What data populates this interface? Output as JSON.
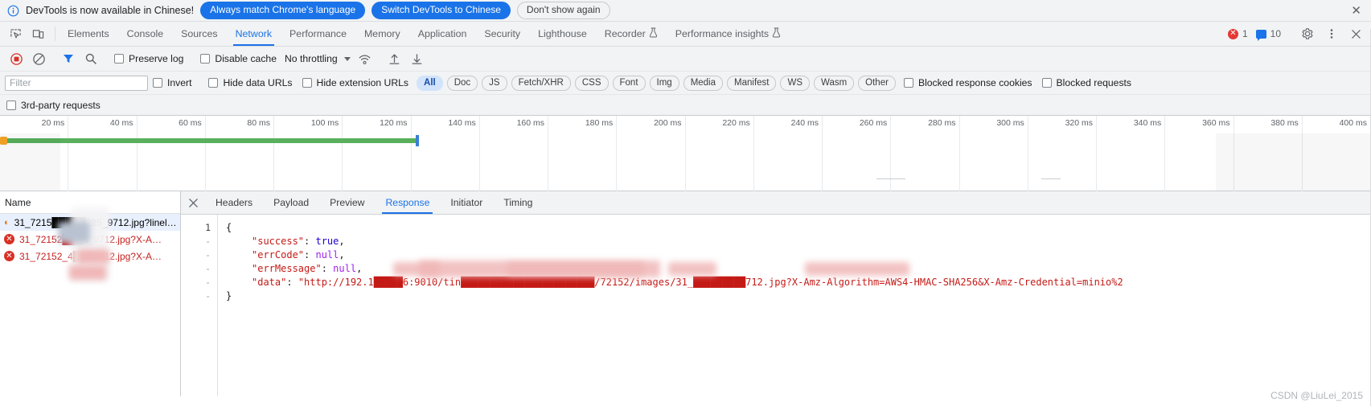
{
  "infobar": {
    "icon": "info-icon",
    "message": "DevTools is now available in Chinese!",
    "btn_always": "Always match Chrome's language",
    "btn_switch": "Switch DevTools to Chinese",
    "btn_dismiss": "Don't show again",
    "close": "✕"
  },
  "tabbar": {
    "inspect_icon": "inspect-element-icon",
    "device_icon": "device-toolbar-icon",
    "tabs": [
      {
        "label": "Elements",
        "active": false,
        "flask": false
      },
      {
        "label": "Console",
        "active": false,
        "flask": false
      },
      {
        "label": "Sources",
        "active": false,
        "flask": false
      },
      {
        "label": "Network",
        "active": true,
        "flask": false
      },
      {
        "label": "Performance",
        "active": false,
        "flask": false
      },
      {
        "label": "Memory",
        "active": false,
        "flask": false
      },
      {
        "label": "Application",
        "active": false,
        "flask": false
      },
      {
        "label": "Security",
        "active": false,
        "flask": false
      },
      {
        "label": "Lighthouse",
        "active": false,
        "flask": false
      },
      {
        "label": "Recorder",
        "active": false,
        "flask": true
      },
      {
        "label": "Performance insights",
        "active": false,
        "flask": true
      }
    ],
    "error_count": "1",
    "message_count": "10",
    "settings_icon": "gear-icon",
    "more_icon": "kebab-menu-icon",
    "close_icon": "close-icon"
  },
  "nettoolbar": {
    "record_icon": "record-stop-icon",
    "clear_icon": "clear-network-icon",
    "filter_icon": "filter-funnel-icon",
    "search_icon": "search-icon",
    "preserve_log": "Preserve log",
    "disable_cache": "Disable cache",
    "throttling": "No throttling",
    "wifi_icon": "network-conditions-icon",
    "import_icon": "import-har-icon",
    "export_icon": "export-har-icon"
  },
  "filterrow": {
    "filter_placeholder": "Filter",
    "filter_value": "",
    "invert": "Invert",
    "hide_data_urls": "Hide data URLs",
    "hide_extension_urls": "Hide extension URLs",
    "type_pills": [
      {
        "label": "All",
        "selected": true
      },
      {
        "label": "Doc",
        "selected": false
      },
      {
        "label": "JS",
        "selected": false
      },
      {
        "label": "Fetch/XHR",
        "selected": false
      },
      {
        "label": "CSS",
        "selected": false
      },
      {
        "label": "Font",
        "selected": false
      },
      {
        "label": "Img",
        "selected": false
      },
      {
        "label": "Media",
        "selected": false
      },
      {
        "label": "Manifest",
        "selected": false
      },
      {
        "label": "WS",
        "selected": false
      },
      {
        "label": "Wasm",
        "selected": false
      },
      {
        "label": "Other",
        "selected": false
      }
    ],
    "blocked_response_cookies": "Blocked response cookies",
    "blocked_requests": "Blocked requests",
    "third_party_requests": "3rd-party requests"
  },
  "overview": {
    "ticks": [
      "20 ms",
      "40 ms",
      "60 ms",
      "80 ms",
      "100 ms",
      "120 ms",
      "140 ms",
      "160 ms",
      "180 ms",
      "200 ms",
      "220 ms",
      "240 ms",
      "260 ms",
      "280 ms",
      "300 ms",
      "320 ms",
      "340 ms",
      "360 ms",
      "380 ms",
      "400 ms"
    ]
  },
  "requests": {
    "column_header": "Name",
    "rows": [
      {
        "name": "31_7215█████285_9712.jpg?linel…",
        "icon": "info-circle-icon",
        "selected": true,
        "error": false
      },
      {
        "name": "31_72152███5_9712.jpg?X-A…",
        "icon": "error-circle-icon",
        "selected": false,
        "error": true
      },
      {
        "name": "31_72152_4███9712.jpg?X-A…",
        "icon": "error-circle-icon",
        "selected": false,
        "error": true
      }
    ]
  },
  "detail": {
    "close_icon": "close-panel-icon",
    "tabs": [
      {
        "label": "Headers",
        "active": false
      },
      {
        "label": "Payload",
        "active": false
      },
      {
        "label": "Preview",
        "active": false
      },
      {
        "label": "Response",
        "active": true
      },
      {
        "label": "Initiator",
        "active": false
      },
      {
        "label": "Timing",
        "active": false
      }
    ],
    "gutter": [
      "1",
      "-",
      "-",
      "-",
      "-",
      "-"
    ],
    "json_lines": [
      {
        "indent": 0,
        "parts": [
          {
            "t": "{",
            "c": "punc"
          }
        ]
      },
      {
        "indent": 1,
        "parts": [
          {
            "t": "\"success\"",
            "c": "k"
          },
          {
            "t": ": ",
            "c": "punc"
          },
          {
            "t": "true",
            "c": "b"
          },
          {
            "t": ",",
            "c": "punc"
          }
        ]
      },
      {
        "indent": 1,
        "parts": [
          {
            "t": "\"errCode\"",
            "c": "k"
          },
          {
            "t": ": ",
            "c": "punc"
          },
          {
            "t": "null",
            "c": "n"
          },
          {
            "t": ",",
            "c": "punc"
          }
        ]
      },
      {
        "indent": 1,
        "parts": [
          {
            "t": "\"errMessage\"",
            "c": "k"
          },
          {
            "t": ": ",
            "c": "punc"
          },
          {
            "t": "null",
            "c": "n"
          },
          {
            "t": ",",
            "c": "punc"
          }
        ]
      },
      {
        "indent": 1,
        "parts": [
          {
            "t": "\"data\"",
            "c": "k"
          },
          {
            "t": ": ",
            "c": "punc"
          },
          {
            "t": "\"http://192.1█████6:9010/tin███████████████████████/72152/images/31_█████████712.jpg?X-Amz-Algorithm=AWS4-HMAC-SHA256&X-Amz-Credential=minio%2",
            "c": "s"
          }
        ]
      },
      {
        "indent": 0,
        "parts": [
          {
            "t": "}",
            "c": "punc"
          }
        ]
      }
    ]
  },
  "watermark": "CSDN @LiuLei_2015"
}
